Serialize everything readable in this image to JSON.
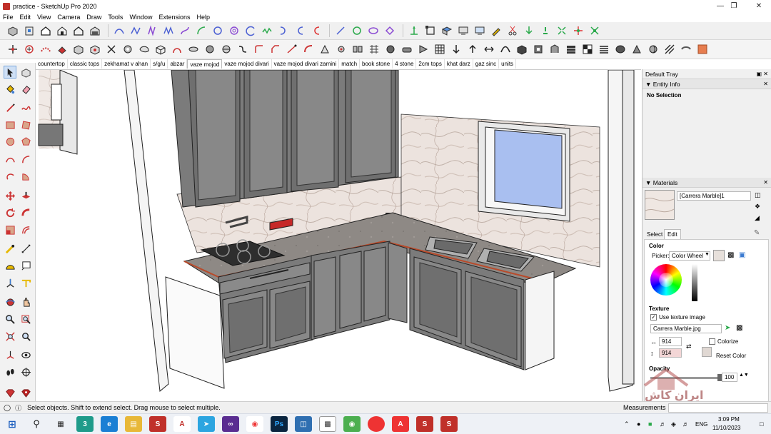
{
  "window": {
    "title": "practice - SketchUp Pro 2020"
  },
  "menu": [
    "File",
    "Edit",
    "View",
    "Camera",
    "Draw",
    "Tools",
    "Window",
    "Extensions",
    "Help"
  ],
  "scenes": [
    "countertop",
    "classic tops",
    "zekhamat v ahan",
    "s/g/u",
    "abzar",
    "vaze mojod",
    "vaze mojod divari",
    "vaze mojod divari zamini",
    "match",
    "book stone",
    "4 stone",
    "2cm tops",
    "khat darz",
    "gaz sinc",
    "units"
  ],
  "active_scene": "vaze mojod",
  "tray": {
    "title": "Default Tray",
    "entity_info": {
      "title": "Entity Info",
      "selection": "No Selection"
    },
    "materials": {
      "title": "Materials",
      "name": "[Carrera Marble]1",
      "tab_select": "Select",
      "tab_edit": "Edit",
      "color_label": "Color",
      "picker_label": "Picker:",
      "picker_value": "Color Wheel",
      "texture_label": "Texture",
      "use_texture": "Use texture image",
      "texture_file": "Carrera Marble.jpg",
      "width": "914",
      "height": "914",
      "colorize": "Colorize",
      "reset_color": "Reset Color",
      "opacity_label": "Opacity",
      "opacity_value": "100"
    }
  },
  "status": {
    "hint": "Select objects. Shift to extend select. Drag mouse to select multiple.",
    "measurements": "Measurements"
  },
  "taskbar": {
    "time": "3:09 PM",
    "date": "11/10/2023",
    "lang": "ENG"
  },
  "watermark": "ایران کاش",
  "colors": {
    "cabinet": "#7b7b7b",
    "counter": "#8d8884",
    "marble": "#ece4df",
    "window_glass": "#a9bff0",
    "accent_red": "#c0302a"
  }
}
